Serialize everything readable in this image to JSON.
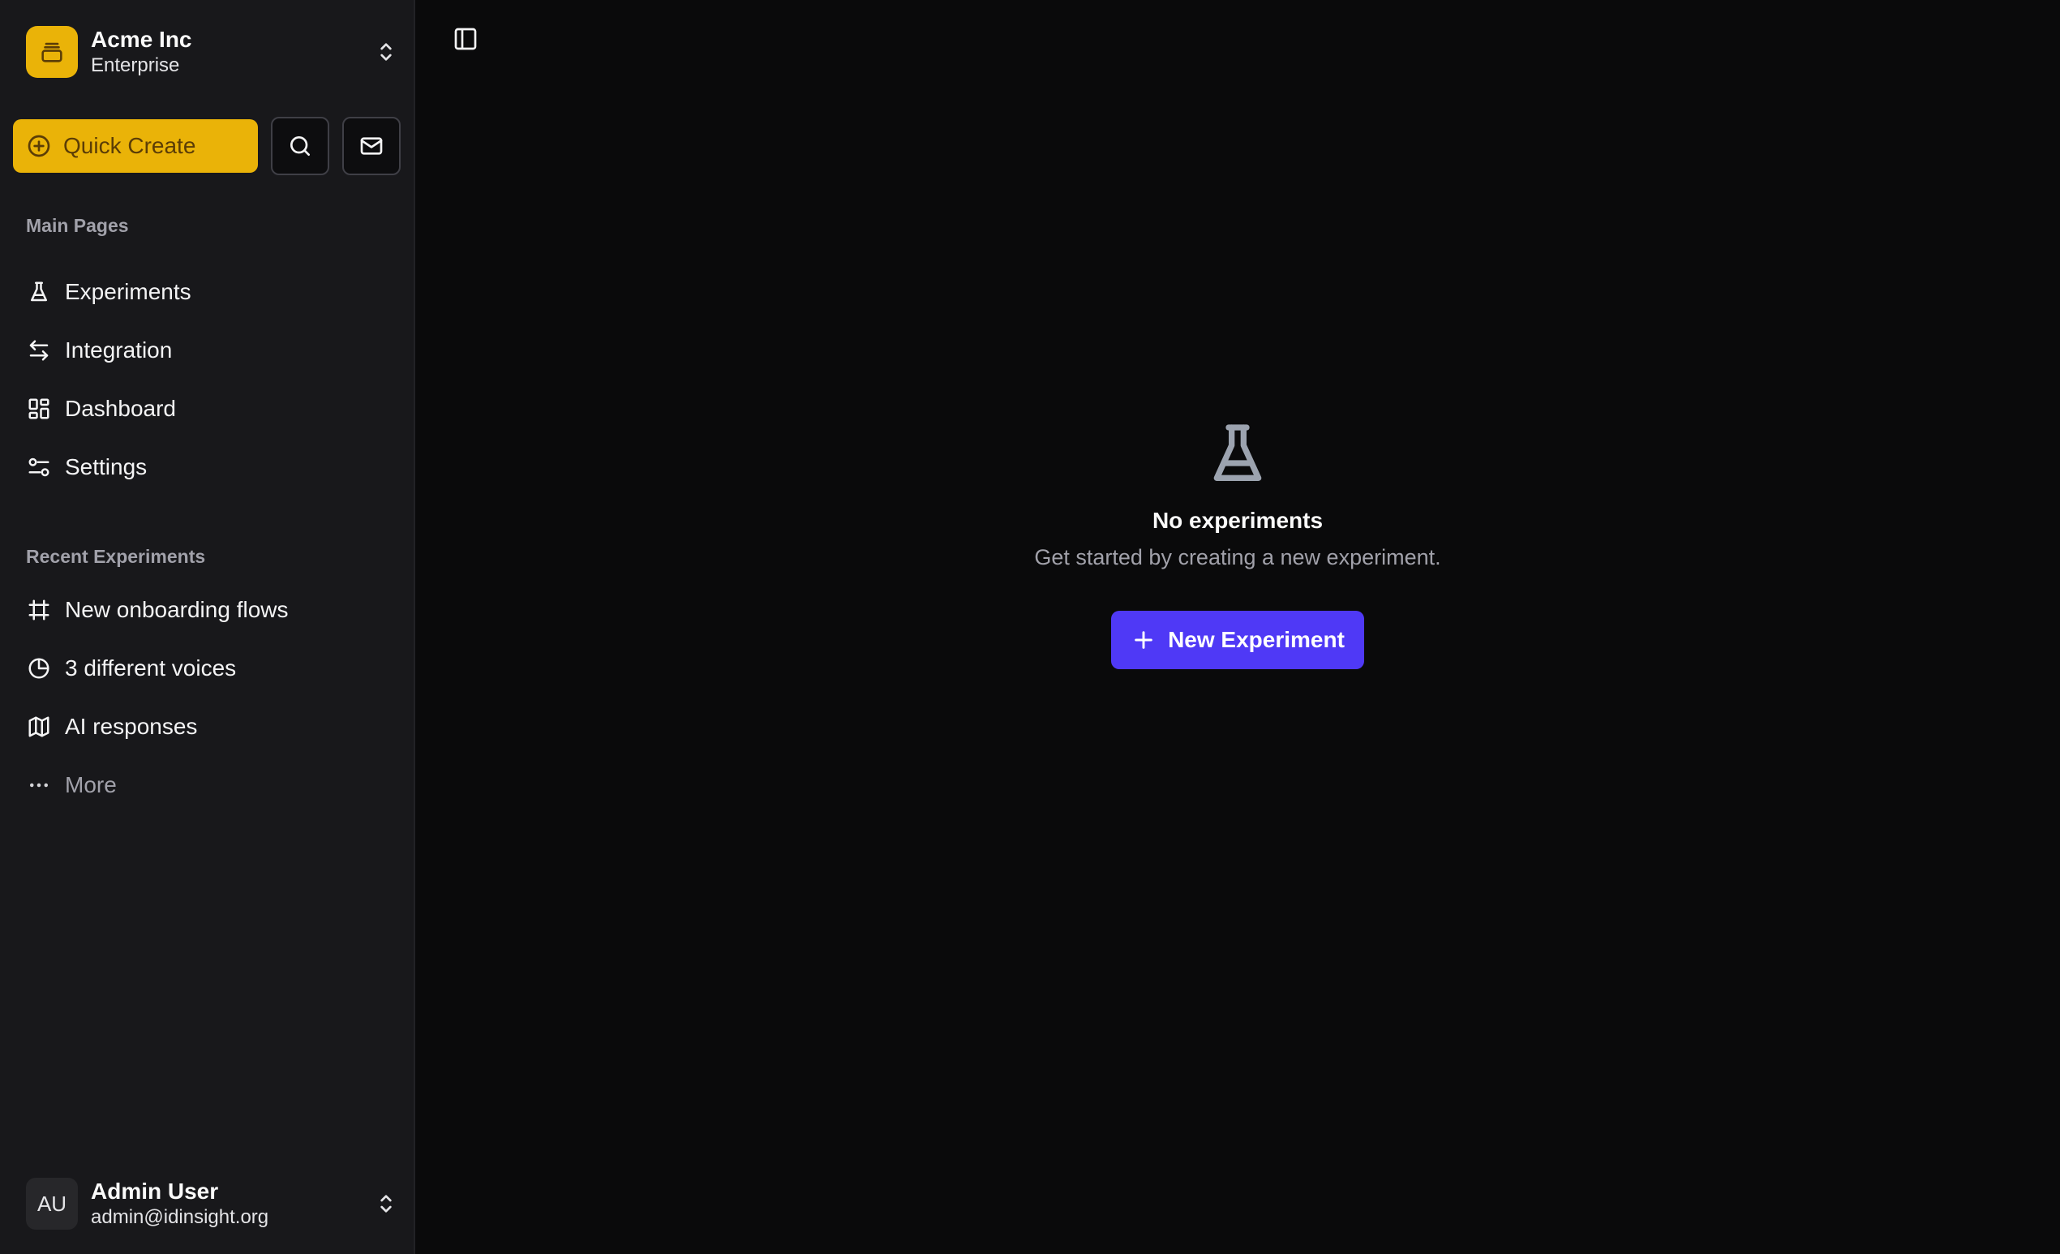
{
  "org": {
    "name": "Acme Inc",
    "plan": "Enterprise"
  },
  "actions": {
    "quick_create": "Quick Create"
  },
  "main_pages": {
    "label": "Main Pages",
    "items": [
      {
        "label": "Experiments",
        "icon": "flask-icon"
      },
      {
        "label": "Integration",
        "icon": "arrows-left-right-icon"
      },
      {
        "label": "Dashboard",
        "icon": "dashboard-grid-icon"
      },
      {
        "label": "Settings",
        "icon": "sliders-icon"
      }
    ]
  },
  "recent": {
    "label": "Recent Experiments",
    "items": [
      {
        "label": "New onboarding flows",
        "icon": "frame-icon"
      },
      {
        "label": "3 different voices",
        "icon": "pie-chart-icon"
      },
      {
        "label": "AI responses",
        "icon": "map-icon"
      }
    ],
    "more": "More"
  },
  "user": {
    "initials": "AU",
    "name": "Admin User",
    "email": "admin@idinsight.org"
  },
  "empty_state": {
    "title": "No experiments",
    "description": "Get started by creating a new experiment.",
    "button": "New Experiment"
  },
  "colors": {
    "accent": "#eab308",
    "primary": "#4f39f6",
    "sidebar_bg": "#18181b",
    "main_bg": "#0a0a0b"
  }
}
